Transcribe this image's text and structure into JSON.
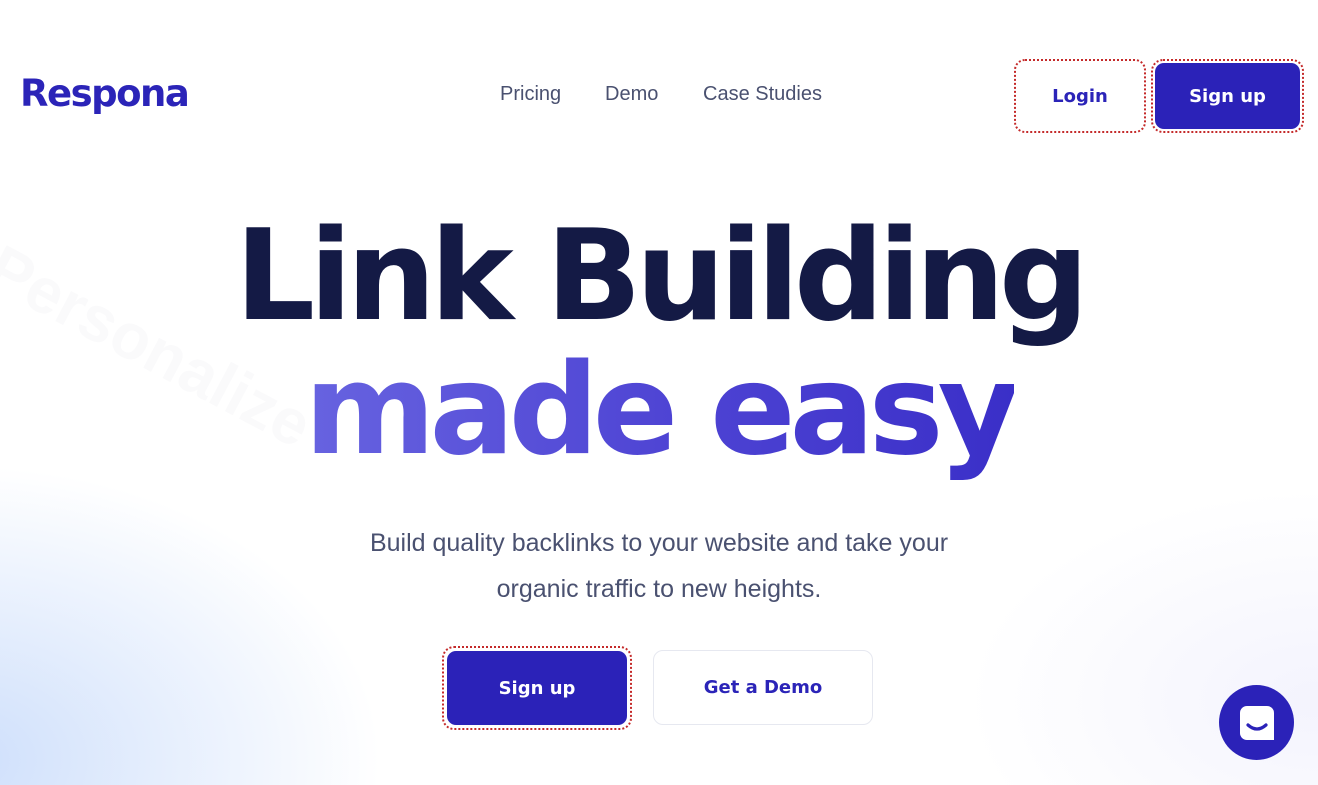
{
  "brand": {
    "logo_text": "Respona",
    "accent_color": "#2b22b8",
    "heading_color": "#141a45"
  },
  "nav": {
    "items": [
      {
        "label": "Pricing"
      },
      {
        "label": "Demo"
      },
      {
        "label": "Case Studies"
      }
    ]
  },
  "header_actions": {
    "login_label": "Login",
    "signup_label": "Sign up"
  },
  "hero": {
    "title_line1": "Link Building",
    "title_line2": "made easy",
    "subtitle": "Build quality backlinks to your website and take your organic traffic to new heights.",
    "primary_cta": "Sign up",
    "secondary_cta": "Get a Demo"
  },
  "chat_widget": {
    "icon": "chat-icon"
  }
}
